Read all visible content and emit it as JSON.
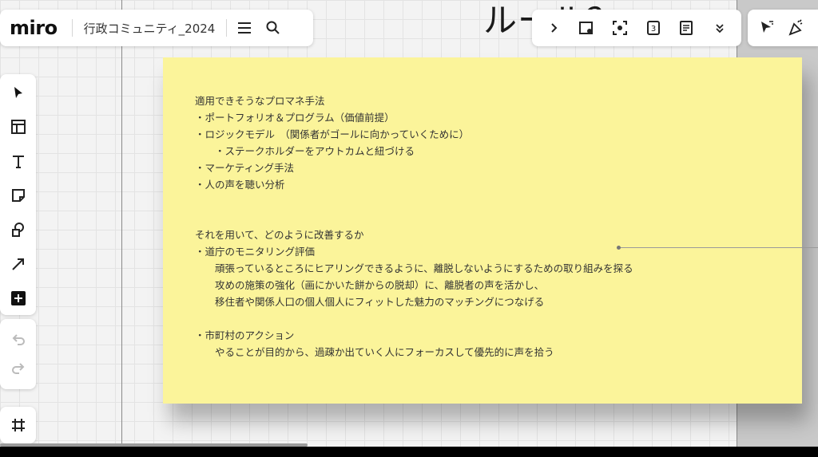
{
  "app": {
    "logo": "miro",
    "board_name": "行政コミュニティ_2024"
  },
  "canvas": {
    "heading_fragment": "ルール？"
  },
  "top_left_toolbar": {
    "menu_icon": "hamburger-menu-icon",
    "search_icon": "search-icon"
  },
  "top_right_toolbar": {
    "icons": [
      "chevron-right-icon",
      "comment-add-icon",
      "focus-frame-icon",
      "timer-icon",
      "notes-icon",
      "chevron-down-icon"
    ],
    "timer_label": "3"
  },
  "top_right_toolbar_2": {
    "icons": [
      "select-cursor-icon",
      "reactions-icon"
    ]
  },
  "left_toolbar": {
    "tools": [
      "select-tool-icon",
      "templates-icon",
      "text-tool-icon",
      "sticky-note-icon",
      "shapes-icon",
      "connector-arrow-icon",
      "add-more-icon"
    ]
  },
  "history": {
    "icons": [
      "undo-icon",
      "redo-icon"
    ]
  },
  "frames": {
    "icon": "frames-panel-icon"
  },
  "sticky_note": {
    "color": "#fbf49a",
    "lines": [
      "適用できそうなプロマネ手法",
      "・ポートフォリオ＆プログラム（価値前提）",
      "・ロジックモデル　（関係者がゴールに向かっていくために）",
      "　　・ステークホルダーをアウトカムと紐づける",
      "・マーケティング手法",
      "・人の声を聴い分析",
      "",
      "",
      "それを用いて、どのように改善するか",
      "・道庁のモニタリング評価",
      "　　頑張っているところにヒアリングできるように、離脱しないようにするための取り組みを探る",
      "　　攻めの施策の強化（画にかいた餅からの脱却）に、離脱者の声を活かし、",
      "　　移住者や関係人口の個人個人にフィットした魅力のマッチングにつなげる",
      "",
      "・市町村のアクション",
      "　　やることが目的から、過疎か出ていく人にフォーカスして優先的に声を拾う"
    ]
  }
}
